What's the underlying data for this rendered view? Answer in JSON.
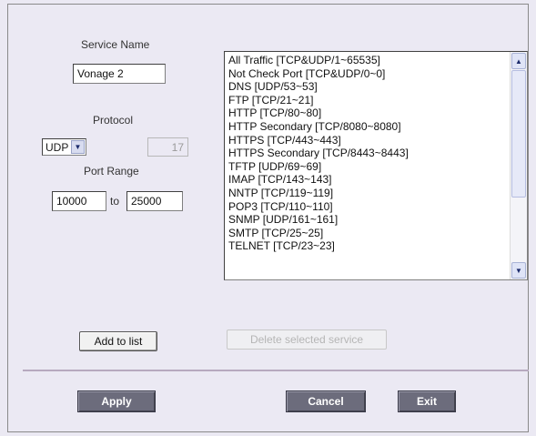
{
  "service_name": {
    "label": "Service Name",
    "value": "Vonage 2"
  },
  "protocol": {
    "label": "Protocol",
    "selected": "UDP",
    "number": "17"
  },
  "port_range": {
    "label": "Port Range",
    "start": "10000",
    "separator": "to",
    "end": "25000"
  },
  "services": [
    "All Traffic [TCP&UDP/1~65535]",
    "Not Check Port [TCP&UDP/0~0]",
    "DNS [UDP/53~53]",
    "FTP [TCP/21~21]",
    "HTTP [TCP/80~80]",
    "HTTP Secondary [TCP/8080~8080]",
    "HTTPS [TCP/443~443]",
    "HTTPS Secondary [TCP/8443~8443]",
    "TFTP [UDP/69~69]",
    "IMAP [TCP/143~143]",
    "NNTP [TCP/119~119]",
    "POP3 [TCP/110~110]",
    "SNMP [UDP/161~161]",
    "SMTP [TCP/25~25]",
    "TELNET [TCP/23~23]"
  ],
  "buttons": {
    "add": "Add to list",
    "delete": "Delete selected service",
    "apply": "Apply",
    "cancel": "Cancel",
    "exit": "Exit"
  },
  "icons": {
    "dropdown": "chevron-down-icon",
    "scroll_up": "chevron-up-icon",
    "scroll_down": "chevron-down-icon"
  },
  "colors": {
    "background": "#ebe9f3",
    "dark_button": "#6c6c7c",
    "divider": "#b7a9bf"
  }
}
